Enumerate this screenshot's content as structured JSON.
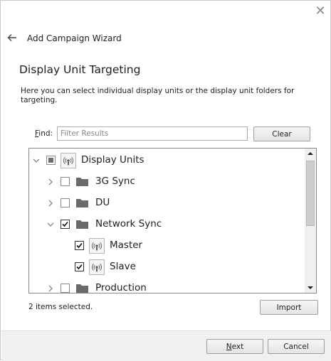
{
  "wizard": {
    "title": "Add Campaign Wizard",
    "section_title": "Display Unit Targeting",
    "description": "Here you can select individual display units or the display unit folders for targeting."
  },
  "find": {
    "label_accel": "F",
    "label_rest": "ind:",
    "placeholder": "Filter Results",
    "value": "",
    "clear_accel": "",
    "clear_label": "Clear"
  },
  "tree": {
    "root": {
      "label": "Display Units",
      "state": "partial",
      "expanded": true
    },
    "items": [
      {
        "label": "3G Sync",
        "checked": false,
        "kind": "folder"
      },
      {
        "label": "DU",
        "checked": false,
        "kind": "folder"
      },
      {
        "label": "Network Sync",
        "checked": true,
        "kind": "folder",
        "expanded": true
      },
      {
        "label": "Master",
        "checked": true,
        "kind": "display-unit"
      },
      {
        "label": "Slave",
        "checked": true,
        "kind": "display-unit"
      },
      {
        "label": "Production",
        "checked": false,
        "kind": "folder"
      }
    ]
  },
  "status": {
    "text": "2 items selected."
  },
  "buttons": {
    "import": "Import",
    "next_accel": "N",
    "next_rest": "ext",
    "cancel": "Cancel"
  },
  "colors": {
    "folder": "#6a6a6a",
    "footer_bg": "#f0f0f0",
    "border": "#828790"
  },
  "icons": {
    "close": "close-icon",
    "back": "back-arrow-icon",
    "folder": "folder-icon",
    "display_unit": "display-unit-icon"
  }
}
